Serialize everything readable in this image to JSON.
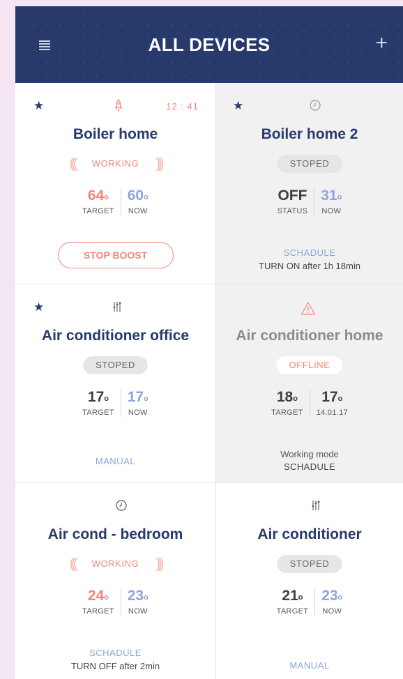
{
  "header": {
    "title": "ALL DEVICES",
    "menu_icon": "hamburger-icon",
    "add_icon": "plus-icon",
    "background": "#283a6b"
  },
  "colors": {
    "accent_red": "#f2867a",
    "accent_blue": "#8da5dc",
    "navy": "#283a6b",
    "card_grey": "#f1f1f1"
  },
  "devices": [
    {
      "name": "Boiler home",
      "favorite": true,
      "mode_icon": "rocket-icon",
      "time": "12 : 41",
      "status": "WORKING",
      "t1": {
        "value": "64",
        "unit": "o",
        "label": "TARGET"
      },
      "t2": {
        "value": "60",
        "unit": "o",
        "label": "NOW"
      },
      "action": "STOP BOOST"
    },
    {
      "name": "Boiler home 2",
      "favorite": true,
      "mode_icon": "clock-icon",
      "status": "STOPED",
      "t1": {
        "value": "OFF",
        "label": "STATUS"
      },
      "t2": {
        "value": "31",
        "unit": "o",
        "label": "NOW"
      },
      "mode_label": "SCHADULE",
      "mode_sub": "TURN ON after 1h 18min"
    },
    {
      "name": "Air conditioner office",
      "favorite": true,
      "mode_icon": "sliders-icon",
      "status": "STOPED",
      "t1": {
        "value": "17",
        "unit": "o",
        "label": "TARGET"
      },
      "t2": {
        "value": "17",
        "unit": "o",
        "label": "NOW"
      },
      "mode_label": "MANUAL"
    },
    {
      "name": "Air conditioner home",
      "favorite": false,
      "mode_icon": "warning-icon",
      "status": "OFFLINE",
      "t1": {
        "value": "18",
        "unit": "o",
        "label": "TARGET"
      },
      "t2": {
        "value": "17",
        "unit": "o",
        "label": "14.01.17"
      },
      "mode_wm": "Working mode",
      "mode_wm2": "SCHADULE"
    },
    {
      "name": "Air cond - bedroom",
      "favorite": false,
      "mode_icon": "clock-icon",
      "status": "WORKING",
      "t1": {
        "value": "24",
        "unit": "o",
        "label": "TARGET"
      },
      "t2": {
        "value": "23",
        "unit": "o",
        "label": "NOW"
      },
      "mode_label": "SCHADULE",
      "mode_sub": "TURN OFF after 2min"
    },
    {
      "name": "Air conditioner",
      "favorite": false,
      "mode_icon": "sliders-icon",
      "status": "STOPED",
      "t1": {
        "value": "21",
        "unit": "o",
        "label": "TARGET"
      },
      "t2": {
        "value": "23",
        "unit": "o",
        "label": "NOW"
      },
      "mode_label": "MANUAL"
    }
  ]
}
